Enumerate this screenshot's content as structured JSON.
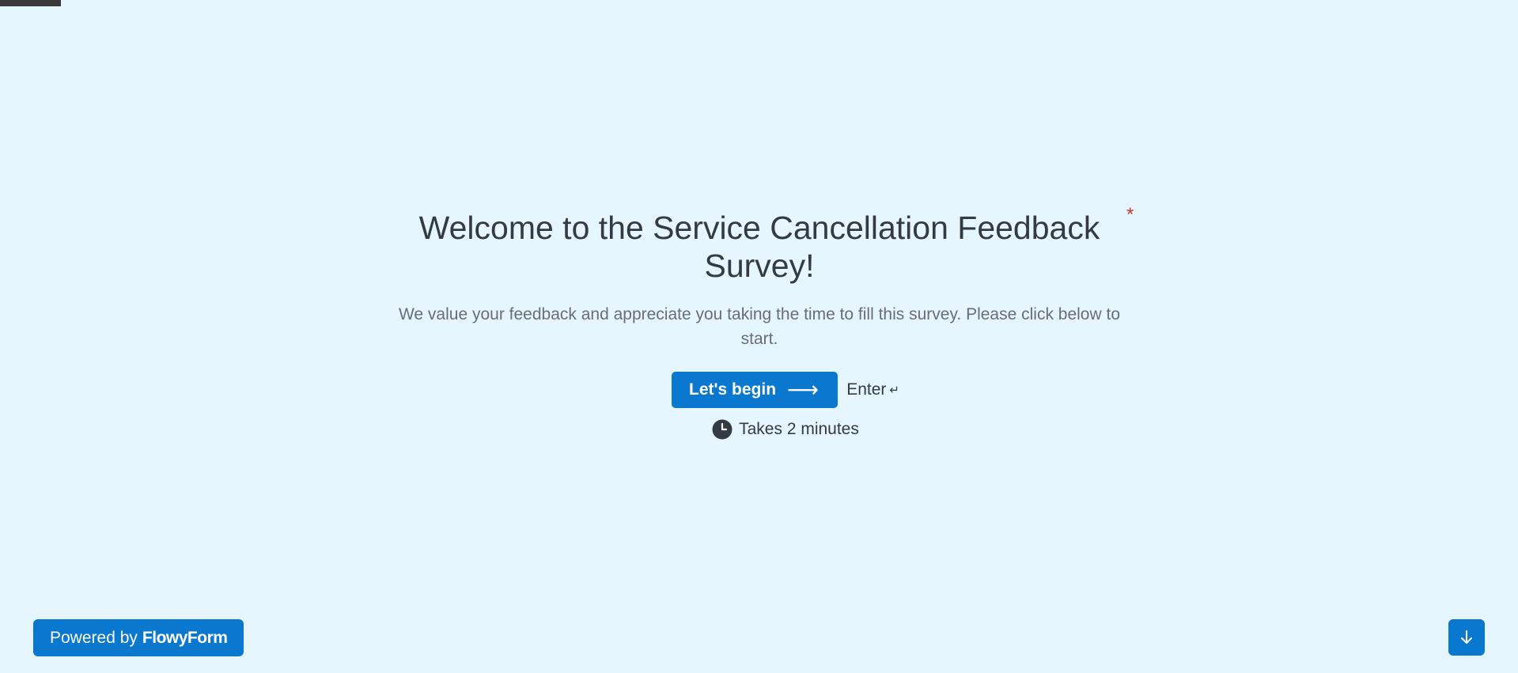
{
  "progress": 0.04,
  "welcome": {
    "title": "Welcome to the Service Cancellation Feedback Survey!",
    "required_marker": "*",
    "subtitle": "We value your feedback and appreciate you taking the time to fill this survey. Please click below to start.",
    "begin_label": "Let's begin",
    "begin_icon": "arrow-right-icon",
    "enter_label": "Enter",
    "enter_icon": "enter-key-icon",
    "time_label": "Takes 2 minutes",
    "time_icon": "clock-icon"
  },
  "footer": {
    "powered_prefix": "Powered by",
    "brand": "FlowyForm",
    "scroll_icon": "arrow-down-icon"
  },
  "colors": {
    "background": "#e5f6ff",
    "accent": "#0b78d0",
    "required": "#c0392b",
    "text": "#333a40",
    "muted_text": "#686e74"
  }
}
